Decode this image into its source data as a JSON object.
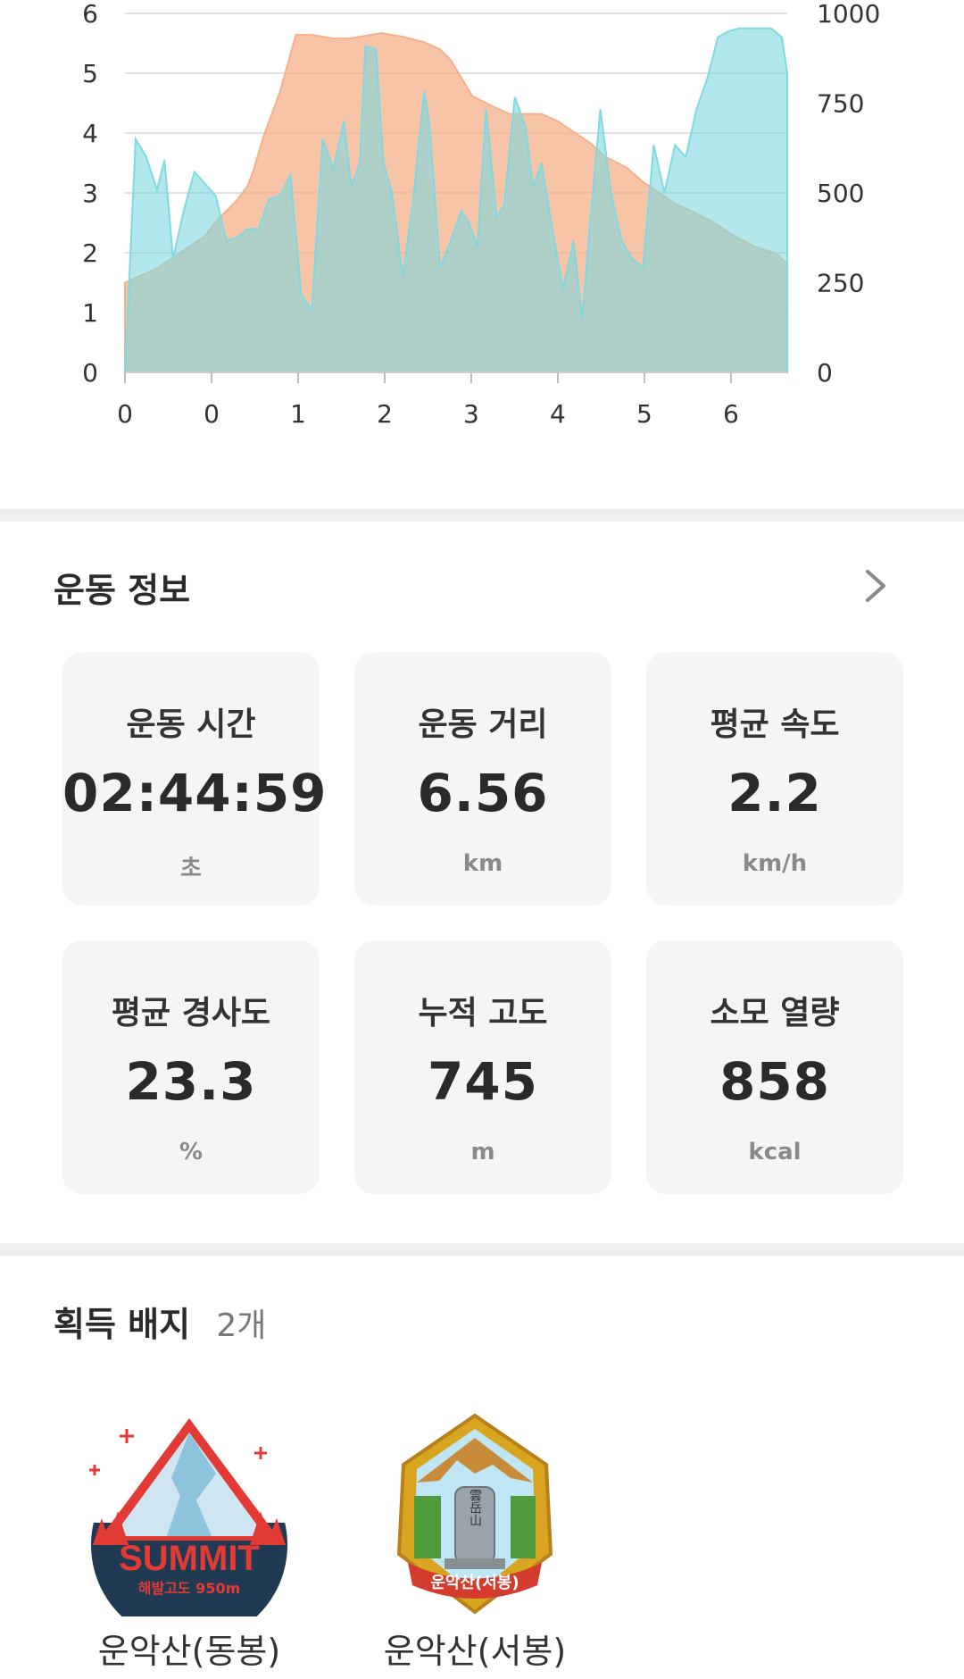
{
  "chart_data": {
    "type": "area",
    "x_ticks": [
      "0",
      "0",
      "1",
      "2",
      "3",
      "4",
      "5",
      "6"
    ],
    "y_left_ticks": [
      "0",
      "1",
      "2",
      "3",
      "4",
      "5",
      "6"
    ],
    "y_right_ticks": [
      "0",
      "250",
      "500",
      "750",
      "1000"
    ],
    "y_left_range": [
      0,
      6
    ],
    "y_right_range": [
      0,
      1000
    ],
    "x_range": [
      0,
      6.2
    ],
    "grid": true,
    "series": [
      {
        "color": "#f5b08a",
        "axis": "right",
        "x": [
          0,
          0.15,
          0.3,
          0.45,
          0.6,
          0.75,
          0.85,
          0.95,
          1.05,
          1.15,
          1.2,
          1.3,
          1.45,
          1.6,
          1.75,
          1.85,
          1.95,
          2.1,
          2.2,
          2.4,
          2.6,
          2.8,
          2.95,
          3.05,
          3.15,
          3.25,
          3.45,
          3.6,
          3.75,
          3.9,
          4.05,
          4.2,
          4.35,
          4.5,
          4.7,
          4.85,
          5.0,
          5.15,
          5.3,
          5.5,
          5.7,
          5.9,
          6.1,
          6.2
        ],
        "y": [
          250,
          270,
          290,
          320,
          350,
          380,
          420,
          450,
          480,
          520,
          560,
          660,
          780,
          940,
          940,
          935,
          930,
          930,
          935,
          945,
          935,
          920,
          900,
          870,
          820,
          770,
          740,
          720,
          720,
          720,
          700,
          670,
          640,
          600,
          570,
          530,
          500,
          470,
          450,
          420,
          380,
          350,
          330,
          300
        ],
        "y_secondary": [
          1.55,
          1.7,
          2.0,
          2.5,
          3.2,
          3.9,
          4.6,
          5.2,
          5.7,
          5.7,
          5.7,
          5.7,
          5.7,
          5.75,
          5.8,
          5.75,
          5.65,
          5.5,
          5.2,
          4.6,
          4.3,
          4.35,
          4.2,
          3.9,
          3.85,
          3.85,
          3.65,
          3.3,
          3.0,
          2.7,
          2.35,
          2.25,
          2.15,
          2.25,
          2.4,
          2.4,
          2.3,
          2.15,
          2.05,
          1.95,
          1.85,
          1.7,
          1.6,
          1.4
        ]
      },
      {
        "color": "#7ed9e0",
        "axis": "left",
        "x": [
          0,
          0.1,
          0.2,
          0.3,
          0.37,
          0.45,
          0.55,
          0.65,
          0.75,
          0.85,
          0.95,
          1.05,
          1.15,
          1.25,
          1.35,
          1.45,
          1.55,
          1.65,
          1.75,
          1.85,
          1.95,
          2.05,
          2.12,
          2.2,
          2.25,
          2.35,
          2.42,
          2.5,
          2.6,
          2.7,
          2.8,
          2.85,
          2.95,
          3.05,
          3.15,
          3.22,
          3.3,
          3.38,
          3.48,
          3.55,
          3.65,
          3.75,
          3.82,
          3.9,
          4.0,
          4.1,
          4.2,
          4.28,
          4.35,
          4.45,
          4.55,
          4.65,
          4.75,
          4.85,
          4.95,
          5.05,
          5.15,
          5.25,
          5.35,
          5.45,
          5.55,
          5.65,
          5.75,
          5.85,
          5.95,
          6.05,
          6.15,
          6.2
        ],
        "y": [
          0,
          3.9,
          3.6,
          3.05,
          3.55,
          1.9,
          2.7,
          3.35,
          3.15,
          2.95,
          2.2,
          2.25,
          2.4,
          2.4,
          2.9,
          2.95,
          3.3,
          1.3,
          1.05,
          3.9,
          3.4,
          4.2,
          3.1,
          3.5,
          5.45,
          5.4,
          3.5,
          3.0,
          1.6,
          2.9,
          4.7,
          4.15,
          1.75,
          2.2,
          2.7,
          2.5,
          2.1,
          4.4,
          2.6,
          2.8,
          4.6,
          4.1,
          3.1,
          3.5,
          2.4,
          1.4,
          2.2,
          0.9,
          2.4,
          4.4,
          3.0,
          2.2,
          1.9,
          1.75,
          3.8,
          3.0,
          3.8,
          3.6,
          4.4,
          4.9,
          5.6,
          5.7,
          5.75,
          5.75,
          5.75,
          5.75,
          5.6,
          5.0
        ]
      }
    ]
  },
  "info": {
    "title": "운동 정보",
    "cards": [
      {
        "label": "운동 시간",
        "value": "02:44:59",
        "unit": "초"
      },
      {
        "label": "운동 거리",
        "value": "6.56",
        "unit": "km"
      },
      {
        "label": "평균 속도",
        "value": "2.2",
        "unit": "km/h"
      },
      {
        "label": "평균 경사도",
        "value": "23.3",
        "unit": "%"
      },
      {
        "label": "누적 고도",
        "value": "745",
        "unit": "m"
      },
      {
        "label": "소모 열량",
        "value": "858",
        "unit": "kcal"
      }
    ]
  },
  "badges": {
    "title": "획득 배지",
    "count": "2개",
    "items": [
      {
        "label": "운악산(동봉)",
        "icon": "summit-badge-icon",
        "badge_text": "SUMMIT",
        "badge_sub": "해발고도 950m"
      },
      {
        "label": "운악산(서봉)",
        "icon": "peak-stone-badge-icon",
        "stone_text": "雲岳山",
        "ribbon_text": "운악산(서봉)"
      }
    ]
  }
}
